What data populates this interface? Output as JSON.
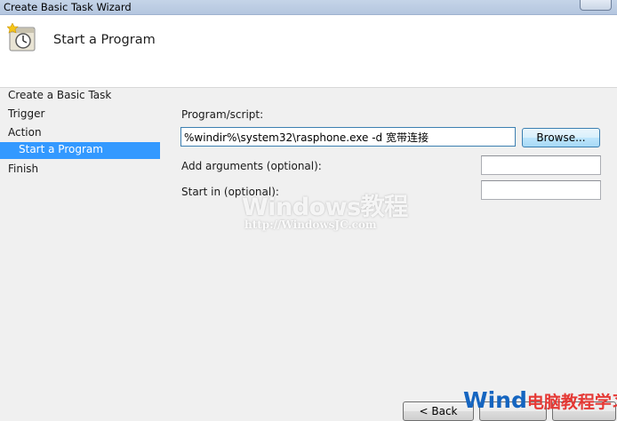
{
  "window": {
    "title": "Create Basic Task Wizard"
  },
  "header": {
    "title": "Start a Program",
    "icon": "task-clock-icon"
  },
  "steps": [
    {
      "label": "Create a Basic Task",
      "active": false,
      "sub": false
    },
    {
      "label": "Trigger",
      "active": false,
      "sub": false
    },
    {
      "label": "Action",
      "active": false,
      "sub": false
    },
    {
      "label": "Start a Program",
      "active": true,
      "sub": true
    },
    {
      "label": "Finish",
      "active": false,
      "sub": false
    }
  ],
  "form": {
    "program_label": "Program/script:",
    "program_value": "%windir%\\system32\\rasphone.exe -d 宽带连接",
    "browse_label": "Browse...",
    "args_label": "Add arguments (optional):",
    "args_value": "",
    "startin_label": "Start in (optional):",
    "startin_value": ""
  },
  "footer": {
    "back_label": "< Back"
  },
  "watermarks": {
    "center_title": "Windows教程",
    "center_url": "http://WindowsJC.com",
    "brand_prefix": "Wind",
    "brand_cn": "电脑教程学习网"
  },
  "colors": {
    "accent": "#3399ff",
    "panel": "#f0f0f0",
    "titlebar": "#bccbe2"
  }
}
